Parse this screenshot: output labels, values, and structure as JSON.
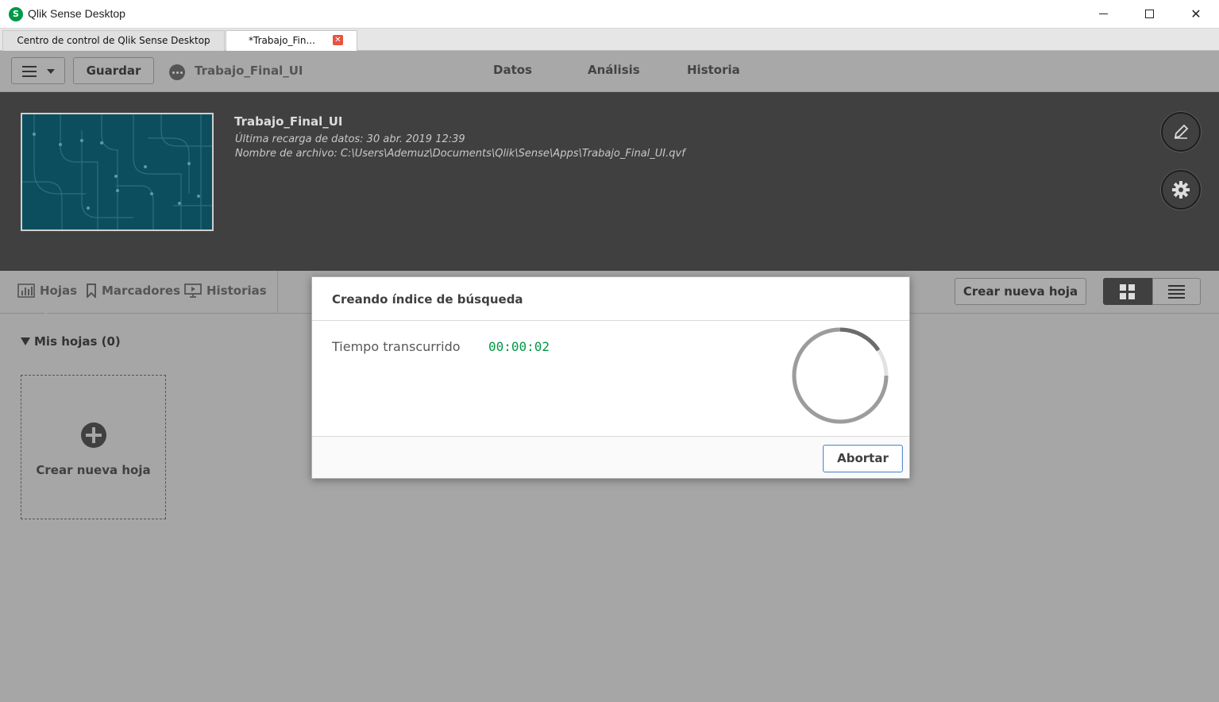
{
  "window": {
    "title": "Qlik Sense Desktop",
    "logo_glyph": "S",
    "minimize_icon": "minimize-icon",
    "maximize_icon": "maximize-icon",
    "close_glyph": "✕"
  },
  "tabs": [
    {
      "label": "Centro de control de Qlik Sense Desktop"
    },
    {
      "label": "*Trabajo_Fin...",
      "close_glyph": "✕"
    }
  ],
  "toolbar": {
    "save_label": "Guardar",
    "app_name": "Trabajo_Final_UI",
    "nav": [
      "Datos",
      "Análisis",
      "Historia"
    ]
  },
  "app_header": {
    "title": "Trabajo_Final_UI",
    "last_reload": "Última recarga de datos: 30 abr. 2019 12:39",
    "file_name": "Nombre de archivo: C:\\Users\\Ademuz\\Documents\\Qlik\\Sense\\Apps\\Trabajo_Final_UI.qvf",
    "edit_icon": "pencil-icon",
    "settings_icon": "gear-icon"
  },
  "subbar": {
    "tabs": [
      {
        "label": "Hojas",
        "icon": "chart-icon"
      },
      {
        "label": "Marcadores",
        "icon": "bookmark-icon"
      },
      {
        "label": "Historias",
        "icon": "presentation-icon"
      }
    ],
    "new_sheet_button": "Crear nueva hoja",
    "view_modes": [
      "grid-view-icon",
      "list-view-icon"
    ]
  },
  "sheets": {
    "section_title": "Mis hojas (0)",
    "new_sheet_card": "Crear nueva hoja"
  },
  "dialog": {
    "title": "Creando índice de búsqueda",
    "elapsed_label": "Tiempo transcurrido",
    "elapsed_value": "00:00:02",
    "abort_label": "Abortar"
  },
  "colors": {
    "accent_green": "#009845",
    "dark_header": "#404040",
    "overlay_gray": "#a6a6a6",
    "thumbnail_teal": "#0d4e5e"
  }
}
